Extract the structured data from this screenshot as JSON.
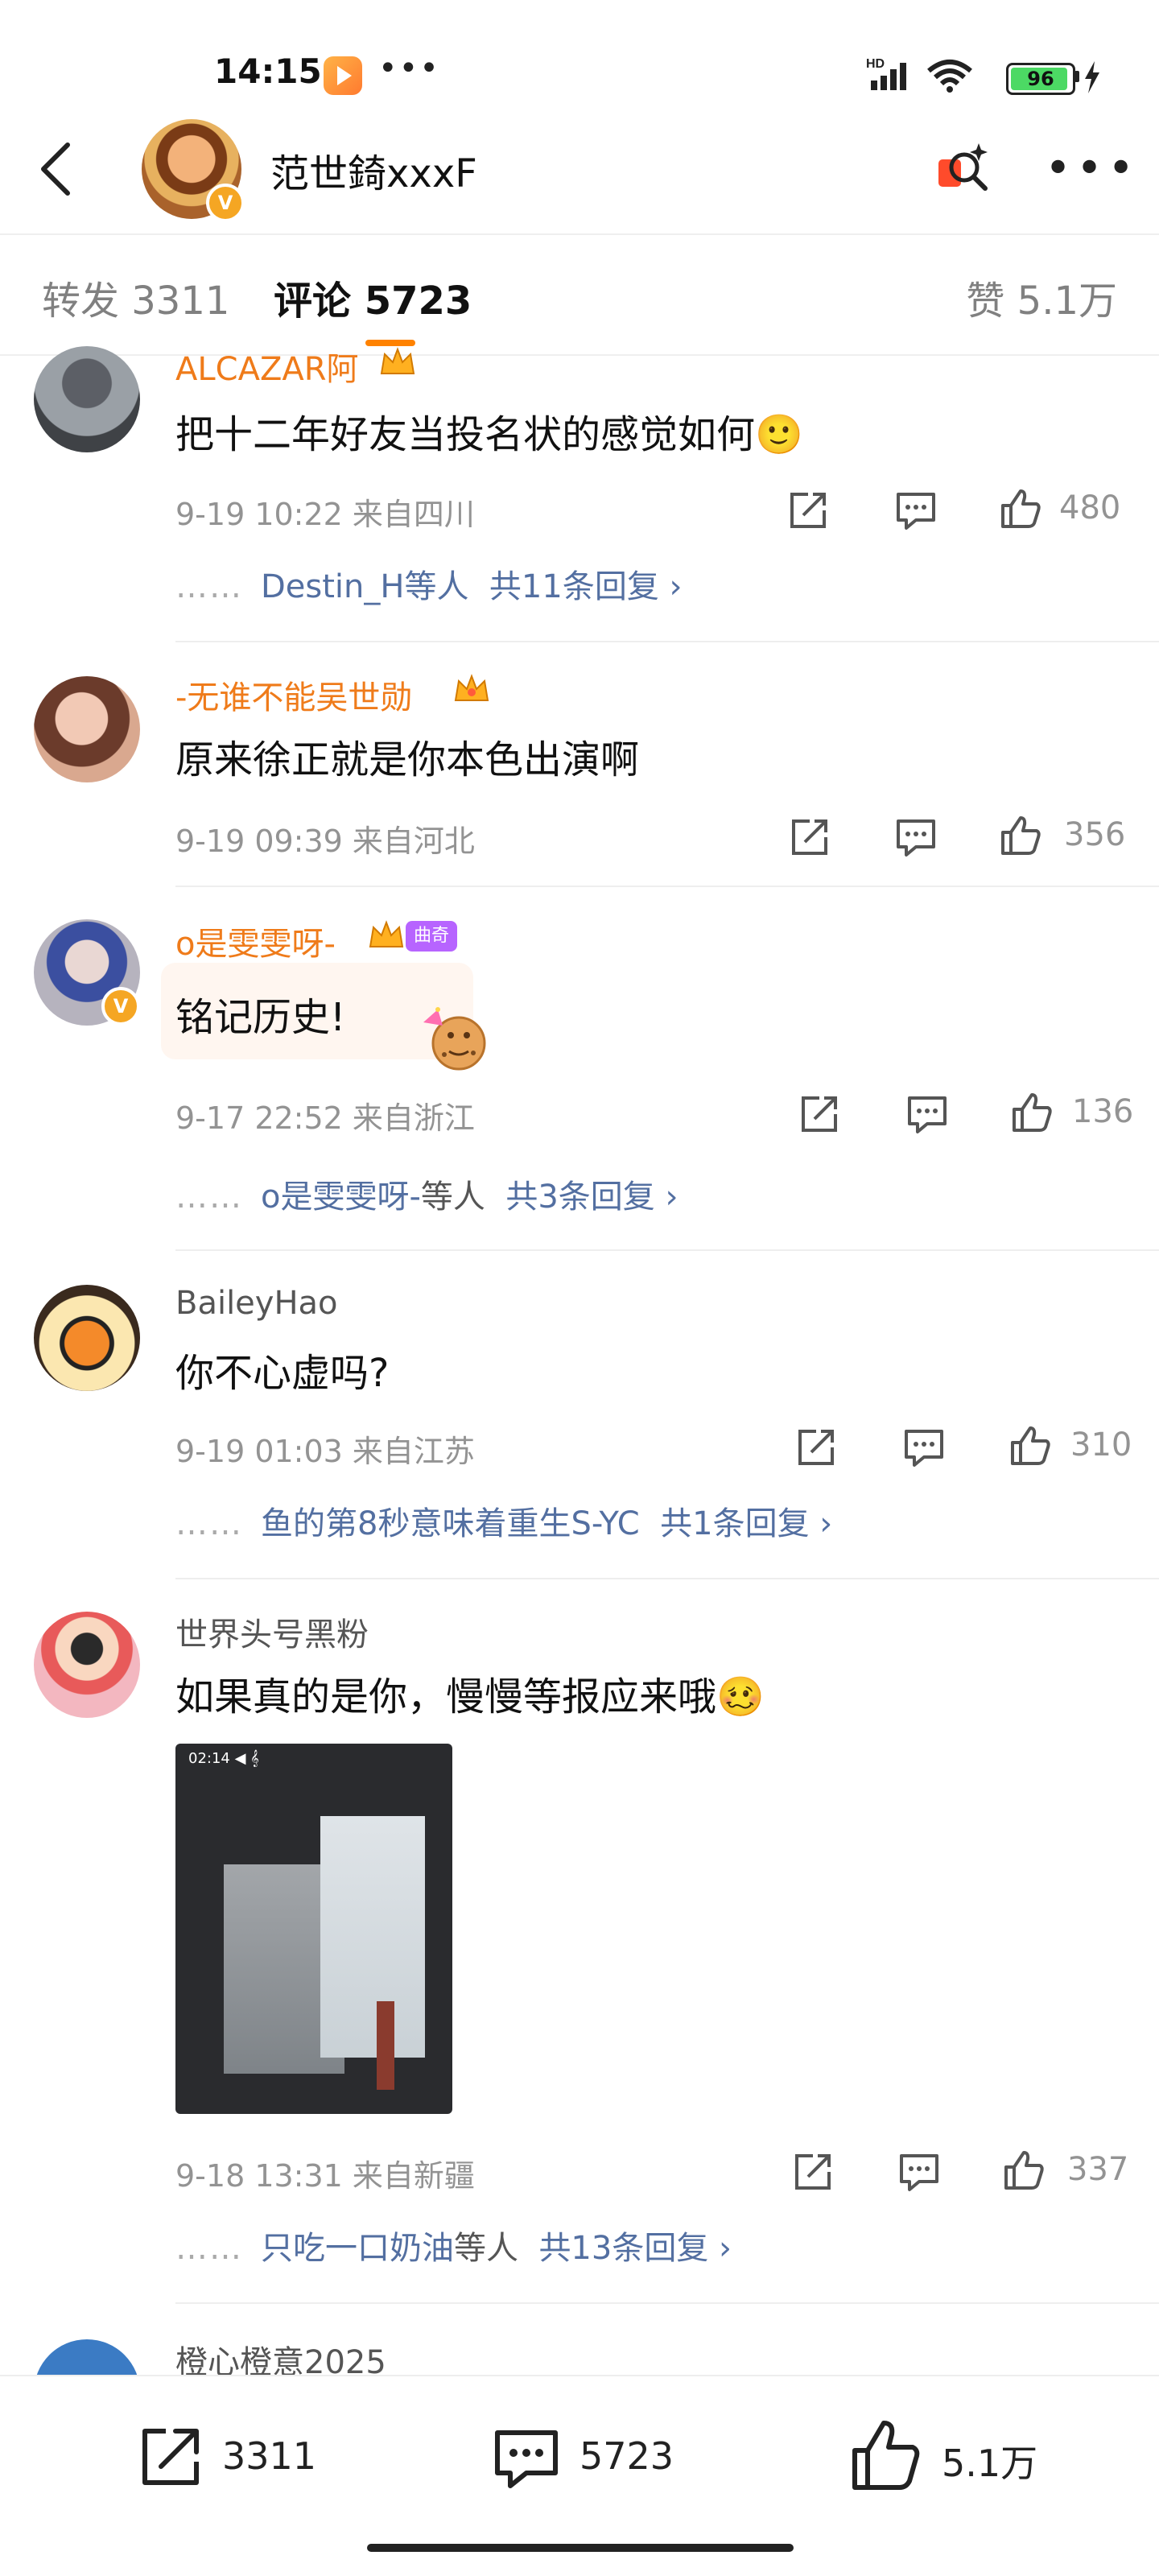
{
  "status_bar": {
    "time": "14:15",
    "more": "•••",
    "network": "HD",
    "battery": "96"
  },
  "header": {
    "title": "范世錡xxxF",
    "verified_badge": "V"
  },
  "tabs": {
    "repost": "转发 3311",
    "comment": "评论 5723",
    "like": "赞 5.1万"
  },
  "comments": [
    {
      "name": "ALCAZAR阿",
      "text": "把十二年好友当投名状的感觉如何🙂",
      "meta": "9-19 10:22  来自四川",
      "likes": "480",
      "replies": {
        "dots": "……",
        "users": "Destin_H等人",
        "count": "共11条回复 ›"
      }
    },
    {
      "name": "-无谁不能吴世勋",
      "text": "原来徐正就是你本色出演啊",
      "meta": "9-19 09:39  来自河北",
      "likes": "356"
    },
    {
      "name": "o是雯雯呀-",
      "medal": "曲奇",
      "text": "铭记历史!",
      "meta": "9-17 22:52  来自浙江",
      "likes": "136",
      "replies": {
        "dots": "……",
        "users": "o是雯雯呀-",
        "users_suffix": "等人",
        "count": "共3条回复 ›"
      }
    },
    {
      "name": "BaileyHao",
      "text": "你不心虚吗?",
      "meta": "9-19 01:03  来自江苏",
      "likes": "310",
      "replies": {
        "dots": "……",
        "users": "鱼的第8秒意味着重生S-YC",
        "count": "共1条回复 ›"
      }
    },
    {
      "name": "世界头号黑粉",
      "text": "如果真的是你，慢慢等报应来哦🥴",
      "meta": "9-18 13:31  来自新疆",
      "likes": "337",
      "replies": {
        "dots": "……",
        "users": "只吃一口奶油",
        "users_suffix": "等人",
        "count": "共13条回复 ›"
      }
    },
    {
      "name": "橙心橙意2025"
    }
  ],
  "bottom_bar": {
    "repost": "3311",
    "comment": "5723",
    "like": "5.1万"
  },
  "colors": {
    "accent": "#ff8200",
    "name_orange": "#ef7b1a",
    "link_blue": "#536fa1",
    "meta_gray": "#939393"
  }
}
